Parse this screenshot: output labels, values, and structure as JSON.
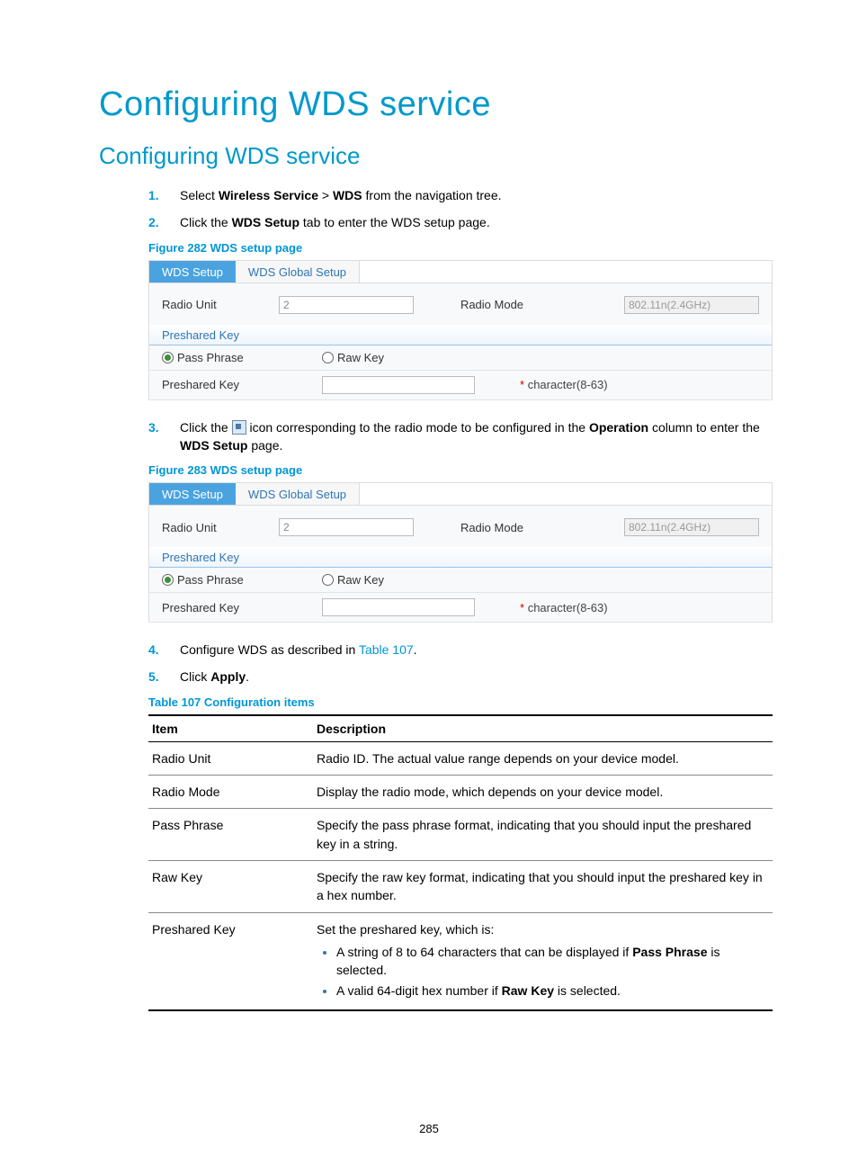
{
  "title": "Configuring WDS service",
  "subtitle": "Configuring WDS service",
  "steps": {
    "s1": {
      "num": "1.",
      "prefix": "Select ",
      "b1": "Wireless Service",
      "gt": " > ",
      "b2": "WDS",
      "suffix": " from the navigation tree."
    },
    "s2": {
      "num": "2.",
      "prefix": "Click the ",
      "b1": "WDS Setup",
      "suffix": " tab to enter the WDS setup page."
    },
    "s3": {
      "num": "3.",
      "prefix": "Click the ",
      "mid": " icon corresponding to the radio mode to be configured in the ",
      "b1": "Operation",
      "mid2": " column to enter the ",
      "b2": "WDS Setup",
      "suffix": " page."
    },
    "s4": {
      "num": "4.",
      "prefix": "Configure WDS as described in ",
      "link": "Table 107",
      "suffix": "."
    },
    "s5": {
      "num": "5.",
      "prefix": "Click ",
      "b1": "Apply",
      "suffix": "."
    }
  },
  "figures": {
    "f282": "Figure 282 WDS setup page",
    "f283": "Figure 283 WDS setup page"
  },
  "table_caption": "Table 107 Configuration items",
  "panel": {
    "tab_active": "WDS Setup",
    "tab_inactive": "WDS Global Setup",
    "radio_unit_label": "Radio Unit",
    "radio_unit_value": "2",
    "radio_mode_label": "Radio Mode",
    "radio_mode_value": "802.11n(2.4GHz)",
    "section": "Preshared Key",
    "pass_phrase": "Pass Phrase",
    "raw_key": "Raw Key",
    "psk_label": "Preshared Key",
    "hint": "character(8-63)"
  },
  "config_table": {
    "h_item": "Item",
    "h_desc": "Description",
    "rows": [
      {
        "item": "Radio Unit",
        "desc": "Radio ID. The actual value range depends on your device model."
      },
      {
        "item": "Radio Mode",
        "desc": "Display the radio mode, which depends on your device model."
      },
      {
        "item": "Pass Phrase",
        "desc": "Specify the pass phrase format, indicating that you should input the preshared key in a string."
      },
      {
        "item": "Raw Key",
        "desc": "Specify the raw key format, indicating that you should input the preshared key in a hex number."
      }
    ],
    "psk": {
      "item": "Preshared Key",
      "intro": "Set the preshared key, which is:",
      "b1a": "A string of 8 to 64 characters that can be displayed if ",
      "b1b": "Pass Phrase",
      "b1c": " is selected.",
      "b2a": "A valid 64-digit hex number if ",
      "b2b": "Raw Key",
      "b2c": " is selected."
    }
  },
  "page_num": "285"
}
